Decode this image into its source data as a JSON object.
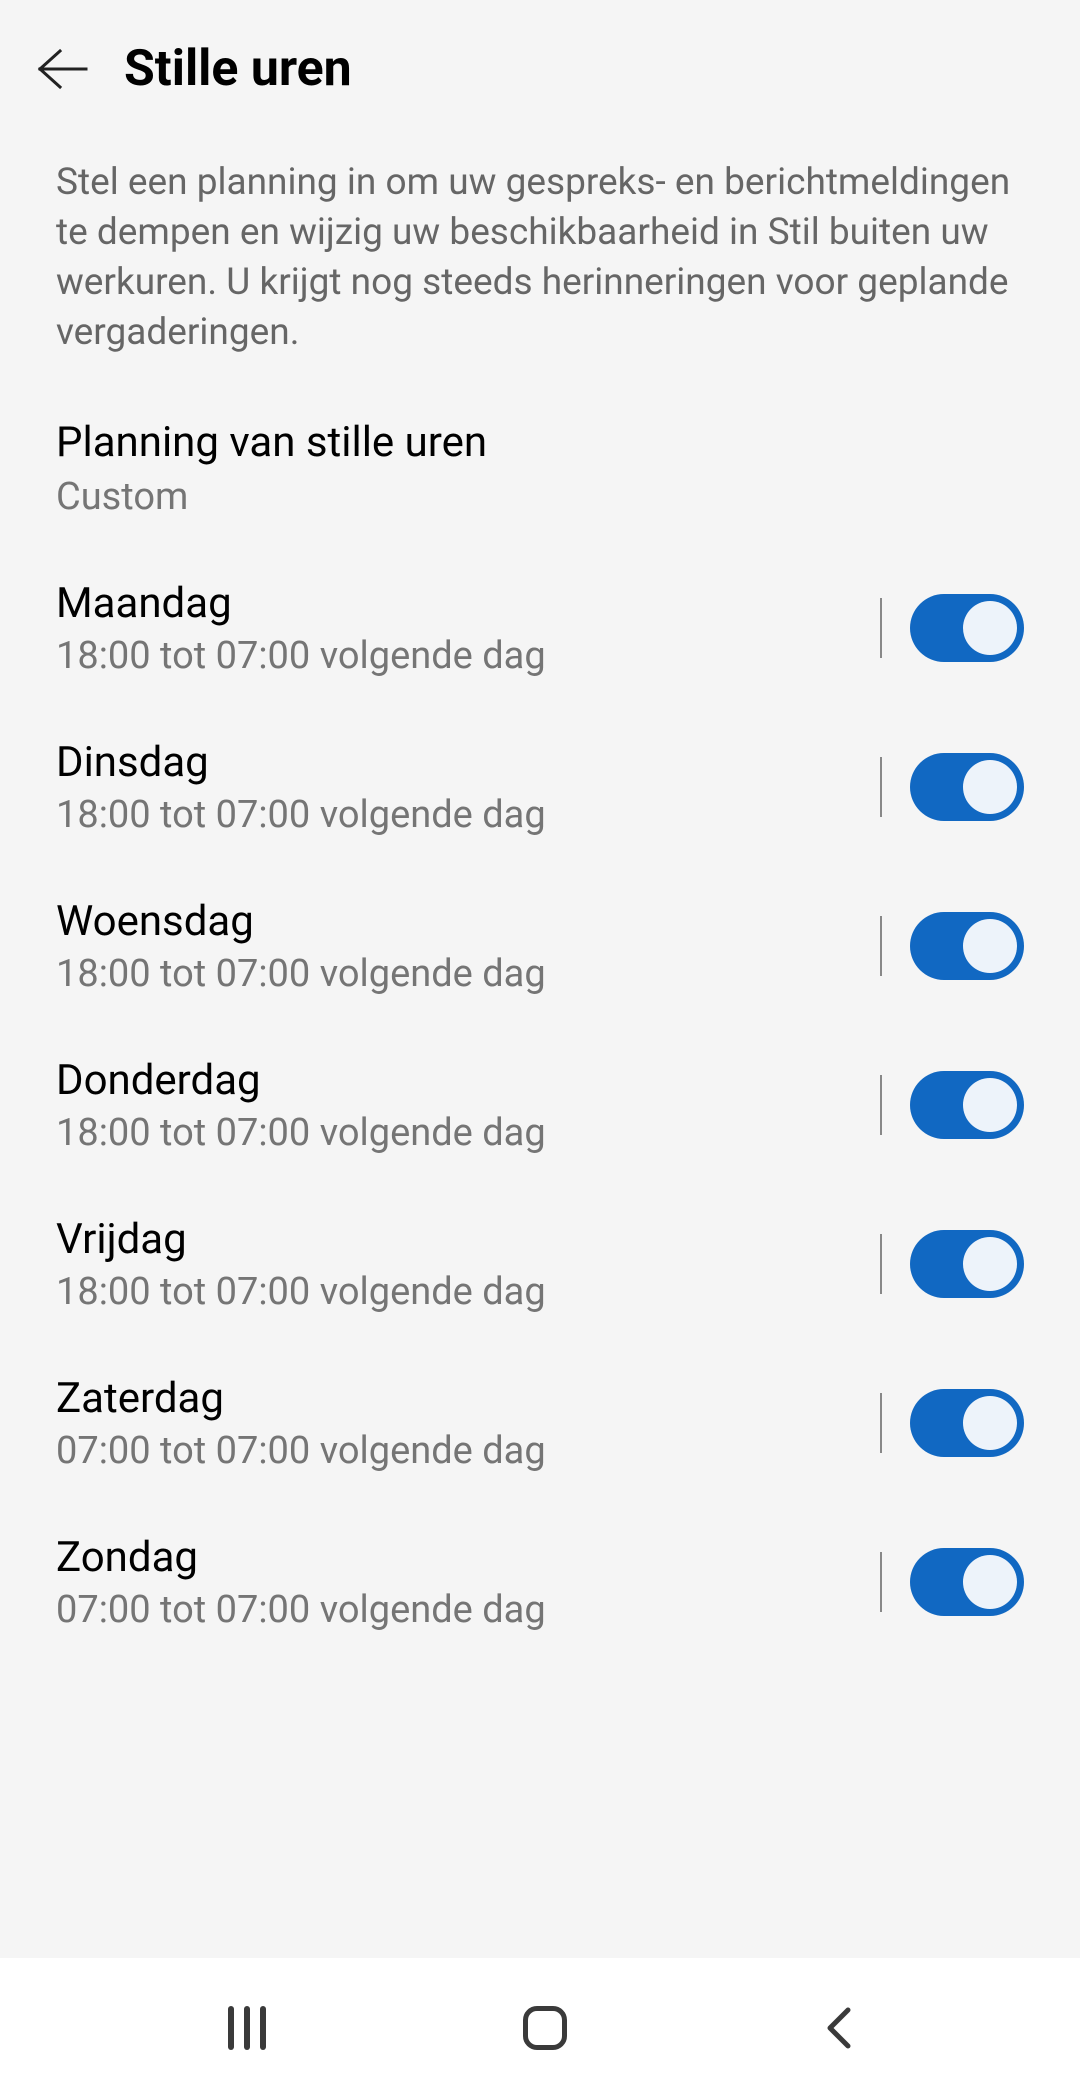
{
  "header": {
    "title": "Stille uren"
  },
  "description": "Stel een planning in om uw gespreks- en berichtmeldingen te dempen en wijzig uw beschikbaarheid in Stil buiten uw werkuren. U krijgt nog steeds herinneringen voor geplande vergaderingen.",
  "schedule": {
    "title": "Planning van stille uren",
    "subtitle": "Custom"
  },
  "days": [
    {
      "name": "Maandag",
      "time": "18:00 tot 07:00 volgende dag",
      "enabled": true
    },
    {
      "name": "Dinsdag",
      "time": "18:00 tot 07:00 volgende dag",
      "enabled": true
    },
    {
      "name": "Woensdag",
      "time": "18:00 tot 07:00 volgende dag",
      "enabled": true
    },
    {
      "name": "Donderdag",
      "time": "18:00 tot 07:00 volgende dag",
      "enabled": true
    },
    {
      "name": "Vrijdag",
      "time": "18:00 tot 07:00 volgende dag",
      "enabled": true
    },
    {
      "name": "Zaterdag",
      "time": "07:00 tot 07:00 volgende dag",
      "enabled": true
    },
    {
      "name": "Zondag",
      "time": "07:00 tot 07:00 volgende dag",
      "enabled": true
    }
  ]
}
